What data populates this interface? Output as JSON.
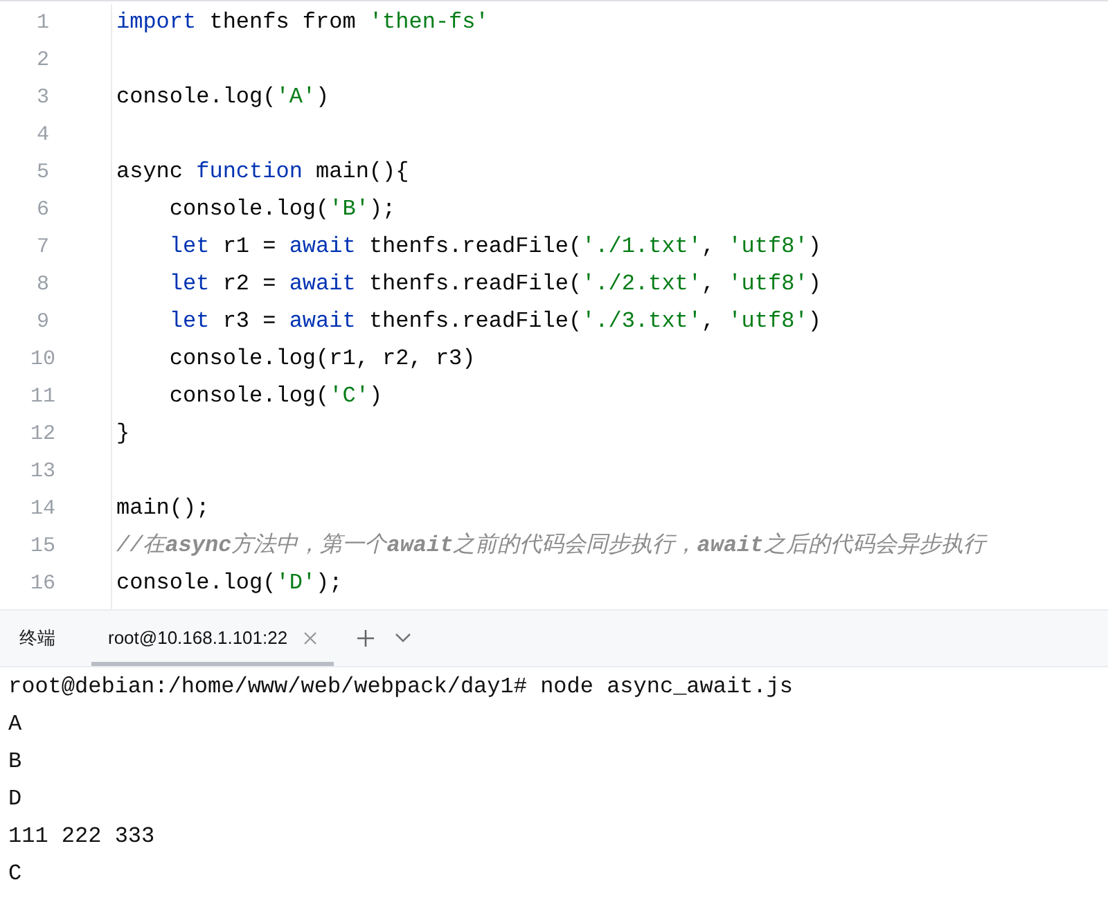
{
  "editor": {
    "lines": [
      {
        "number": "1",
        "tokens": [
          {
            "kind": "keyword",
            "text": "import"
          },
          {
            "kind": "plain",
            "text": " thenfs "
          },
          {
            "kind": "plain",
            "text": "from "
          },
          {
            "kind": "string",
            "text": "'then-fs'"
          }
        ]
      },
      {
        "number": "2"
      },
      {
        "number": "3",
        "tokens": [
          {
            "kind": "plain",
            "text": "console.log("
          },
          {
            "kind": "string",
            "text": "'A'"
          },
          {
            "kind": "plain",
            "text": ")"
          }
        ]
      },
      {
        "number": "4"
      },
      {
        "number": "5",
        "tokens": [
          {
            "kind": "plain",
            "text": "async "
          },
          {
            "kind": "keyword",
            "text": "function"
          },
          {
            "kind": "plain",
            "text": " main(){"
          }
        ]
      },
      {
        "number": "6",
        "tokens": [
          {
            "kind": "plain",
            "text": "    console.log("
          },
          {
            "kind": "string",
            "text": "'B'"
          },
          {
            "kind": "plain",
            "text": ");"
          }
        ]
      },
      {
        "number": "7",
        "tokens": [
          {
            "kind": "keyword",
            "text": "    let"
          },
          {
            "kind": "plain",
            "text": " r1 = "
          },
          {
            "kind": "keyword",
            "text": "await"
          },
          {
            "kind": "plain",
            "text": " thenfs.readFile("
          },
          {
            "kind": "string",
            "text": "'./1.txt'"
          },
          {
            "kind": "plain",
            "text": ", "
          },
          {
            "kind": "string",
            "text": "'utf8'"
          },
          {
            "kind": "plain",
            "text": ")"
          }
        ]
      },
      {
        "number": "8",
        "tokens": [
          {
            "kind": "keyword",
            "text": "    let"
          },
          {
            "kind": "plain",
            "text": " r2 = "
          },
          {
            "kind": "keyword",
            "text": "await"
          },
          {
            "kind": "plain",
            "text": " thenfs.readFile("
          },
          {
            "kind": "string",
            "text": "'./2.txt'"
          },
          {
            "kind": "plain",
            "text": ", "
          },
          {
            "kind": "string",
            "text": "'utf8'"
          },
          {
            "kind": "plain",
            "text": ")"
          }
        ]
      },
      {
        "number": "9",
        "tokens": [
          {
            "kind": "keyword",
            "text": "    let"
          },
          {
            "kind": "plain",
            "text": " r3 = "
          },
          {
            "kind": "keyword",
            "text": "await"
          },
          {
            "kind": "plain",
            "text": " thenfs.readFile("
          },
          {
            "kind": "string",
            "text": "'./3.txt'"
          },
          {
            "kind": "plain",
            "text": ", "
          },
          {
            "kind": "string",
            "text": "'utf8'"
          },
          {
            "kind": "plain",
            "text": ")"
          }
        ]
      },
      {
        "number": "10",
        "tokens": [
          {
            "kind": "plain",
            "text": "    console.log(r1, r2, r3)"
          }
        ]
      },
      {
        "number": "11",
        "tokens": [
          {
            "kind": "plain",
            "text": "    console.log("
          },
          {
            "kind": "string",
            "text": "'C'"
          },
          {
            "kind": "plain",
            "text": ")"
          }
        ]
      },
      {
        "number": "12",
        "tokens": [
          {
            "kind": "plain",
            "text": "}"
          }
        ]
      },
      {
        "number": "13"
      },
      {
        "number": "14",
        "tokens": [
          {
            "kind": "plain",
            "text": "main();"
          }
        ]
      },
      {
        "number": "15",
        "tokens": [
          {
            "kind": "comment",
            "text": "//在**async**方法中，第一个**await**之前的代码会同步执行，**await**之后的代码会异步执行"
          }
        ]
      },
      {
        "number": "16",
        "tokens": [
          {
            "kind": "plain",
            "text": "console.log("
          },
          {
            "kind": "string",
            "text": "'D'"
          },
          {
            "kind": "plain",
            "text": ");"
          }
        ]
      }
    ]
  },
  "terminal": {
    "title": "终端",
    "tabs": [
      {
        "label": "root@10.168.1.101:22",
        "selected": true
      }
    ],
    "output": [
      "root@debian:/home/www/web/webpack/day1# node async_await.js",
      "A",
      "B",
      "D",
      "111 222 333",
      "C"
    ]
  }
}
